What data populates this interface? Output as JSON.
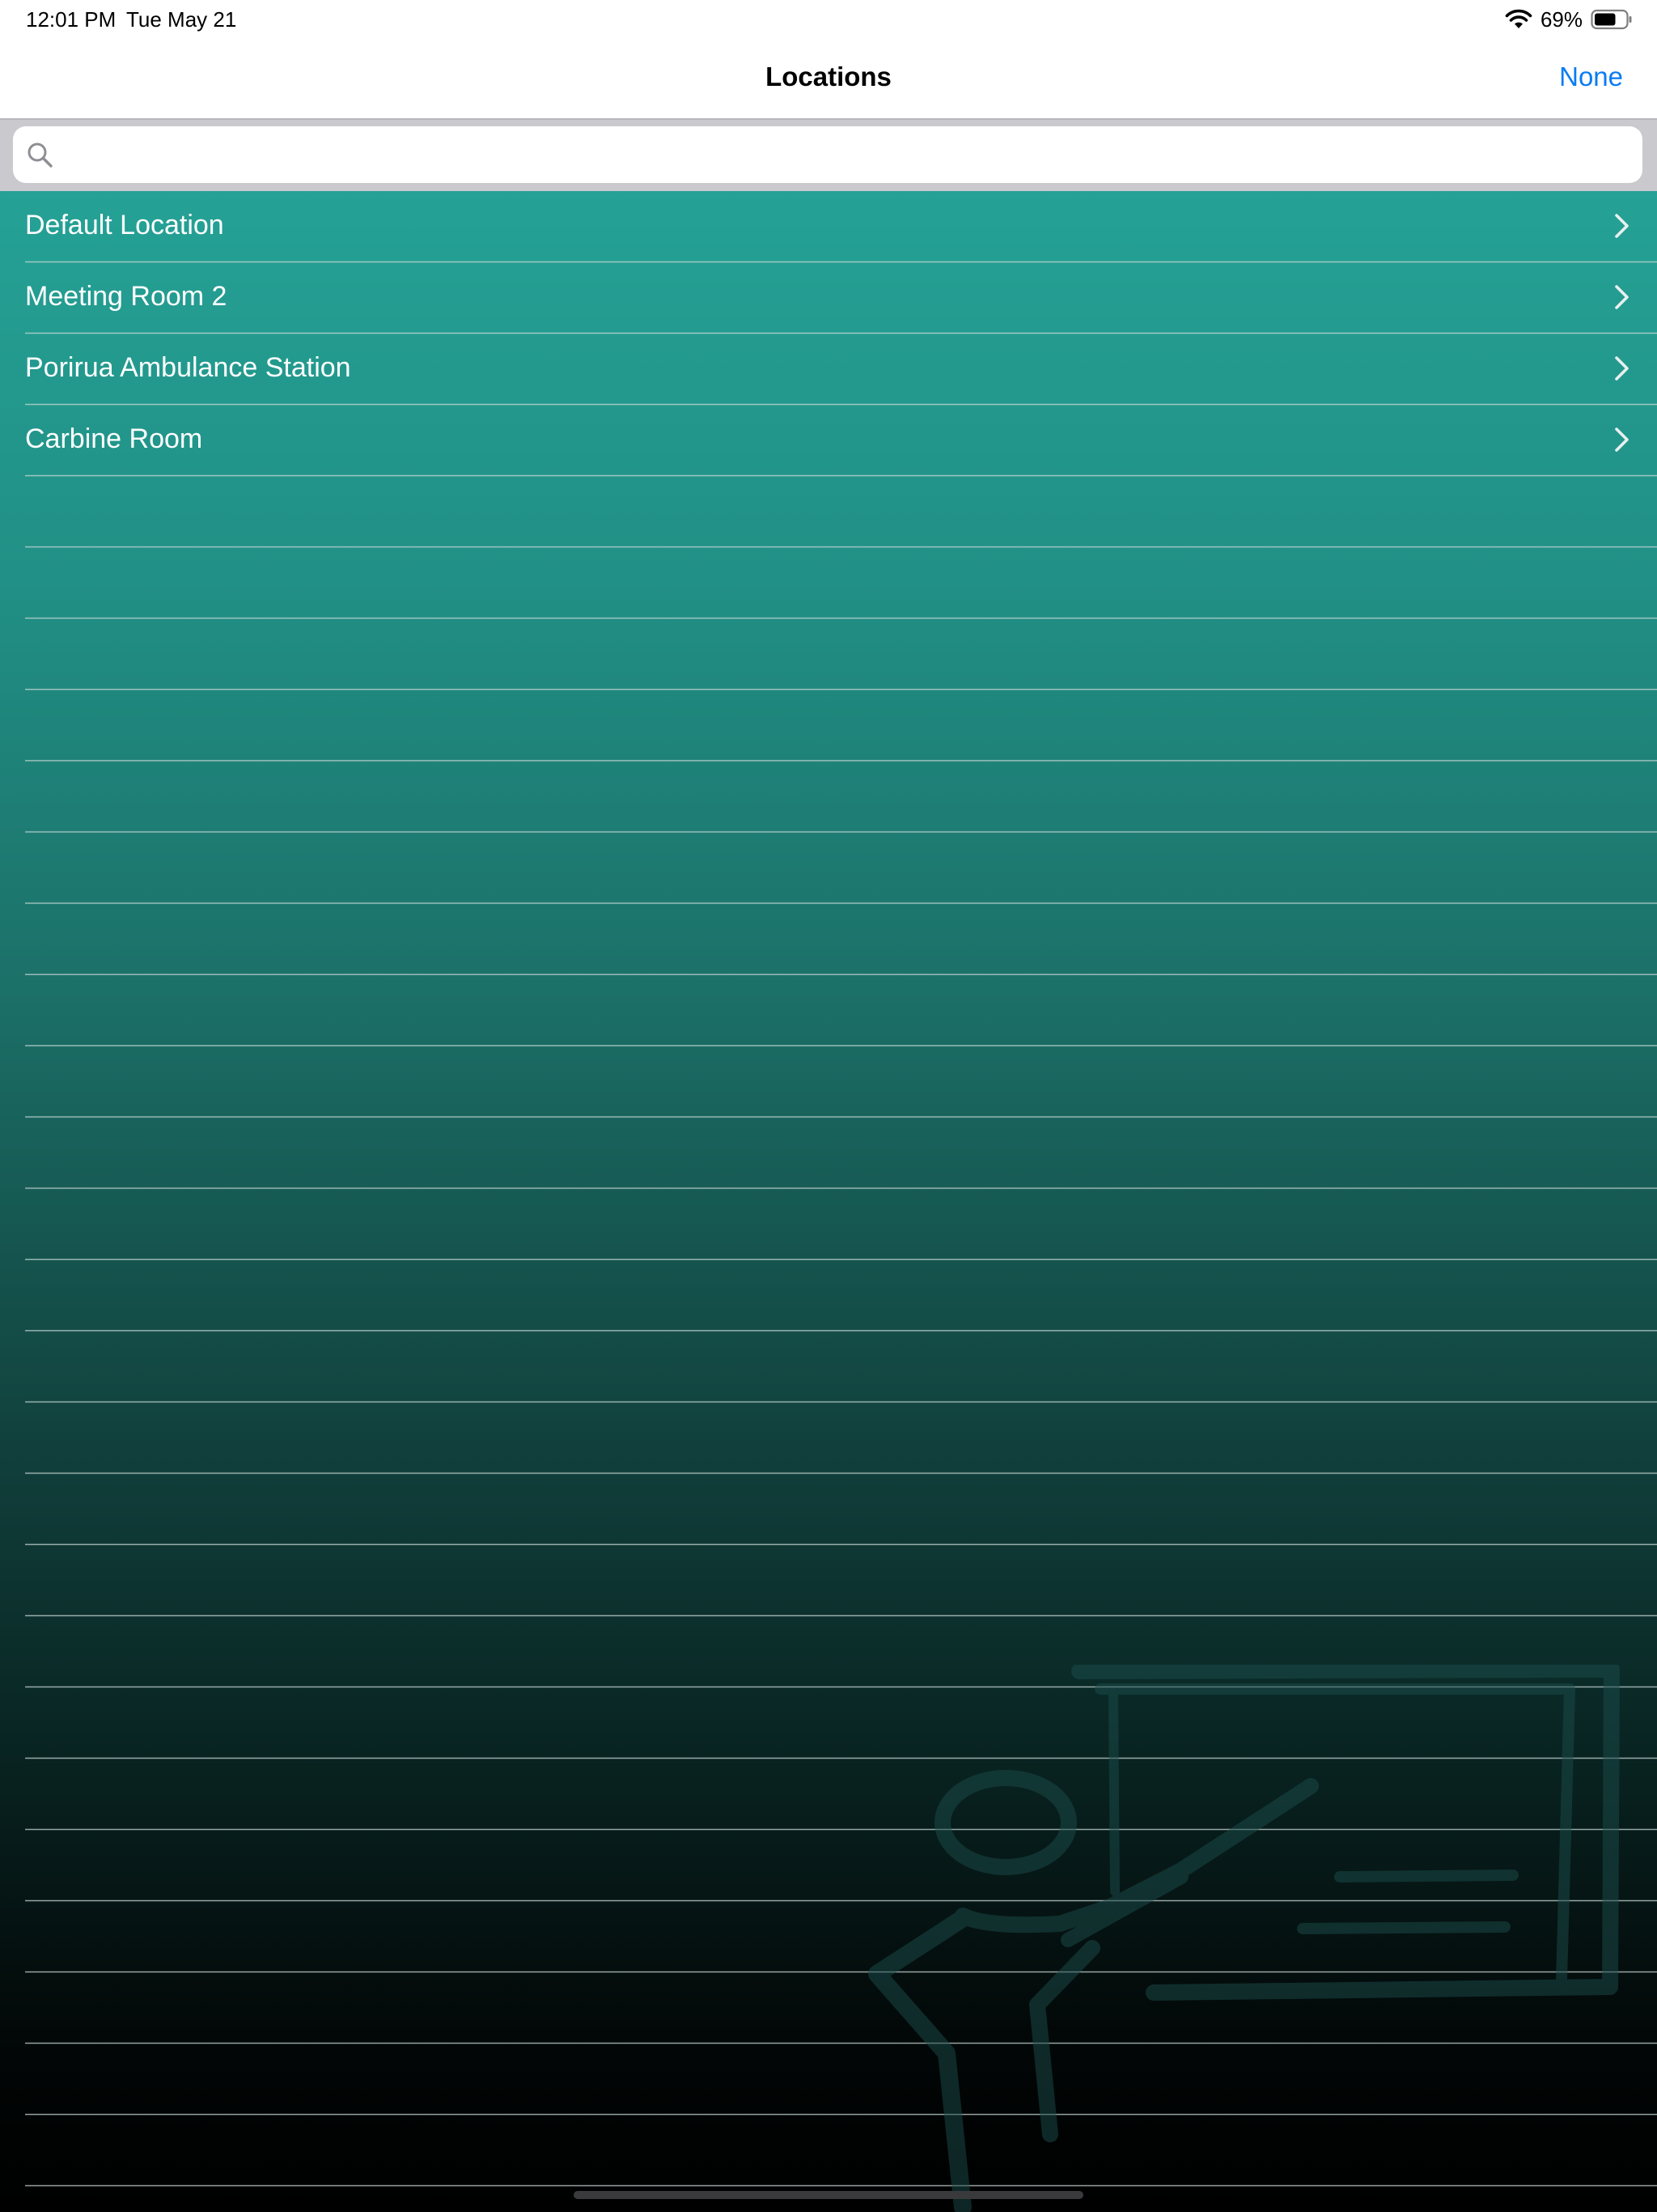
{
  "status_bar": {
    "time": "12:01 PM",
    "date": "Tue May 21",
    "battery_percent": "69%",
    "battery_level": 0.69,
    "wifi_icon": "wifi-icon",
    "battery_icon": "battery-icon"
  },
  "nav": {
    "title": "Locations",
    "right_button": "None"
  },
  "search": {
    "placeholder": "",
    "value": "",
    "icon": "search-icon"
  },
  "locations": [
    {
      "label": "Default Location"
    },
    {
      "label": "Meeting Room 2"
    },
    {
      "label": "Porirua Ambulance Station"
    },
    {
      "label": "Carbine Room"
    }
  ],
  "colors": {
    "accent": "#0a7cf2",
    "list_top": "#25a195",
    "list_bottom": "#000000",
    "separator": "#c8d8d6"
  }
}
